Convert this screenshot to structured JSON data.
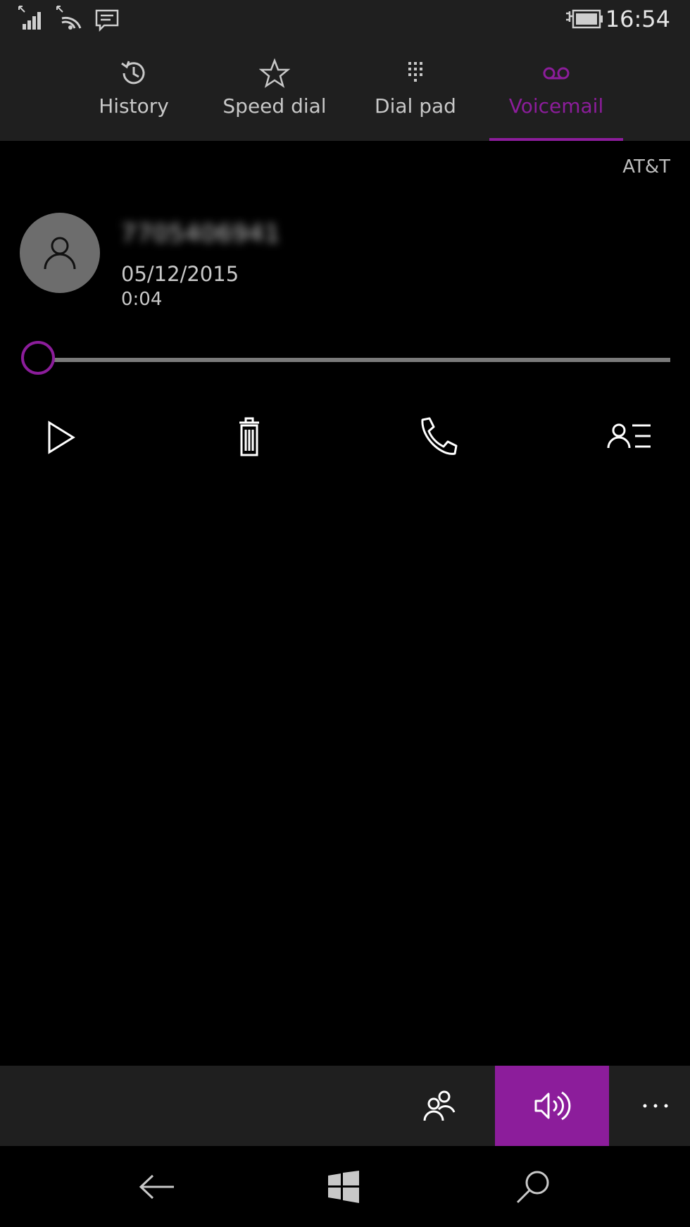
{
  "status": {
    "time": "16:54",
    "icons": [
      "signal-strength-icon",
      "wifi-icon",
      "message-notification-icon",
      "battery-charging-icon"
    ]
  },
  "tabs": [
    {
      "label": "History",
      "icon": "history-icon"
    },
    {
      "label": "Speed dial",
      "icon": "star-icon"
    },
    {
      "label": "Dial pad",
      "icon": "dialpad-icon"
    },
    {
      "label": "Voicemail",
      "icon": "voicemail-icon",
      "active": true
    }
  ],
  "carrier": "AT&T",
  "voicemail": {
    "caller": "7705406941",
    "date": "05/12/2015",
    "duration": "0:04",
    "progress": 0
  },
  "actions": [
    "play-icon",
    "delete-icon",
    "call-icon",
    "contact-details-icon"
  ],
  "appbar": {
    "buttons": [
      "people-icon",
      "speaker-icon",
      "more-icon"
    ],
    "more_label": "..."
  },
  "navbar": [
    "back-icon",
    "windows-start-icon",
    "search-icon"
  ],
  "colors": {
    "accent": "#8c1d9b",
    "bar_background": "#1f1f1f",
    "avatar": "#6d6d6d"
  }
}
